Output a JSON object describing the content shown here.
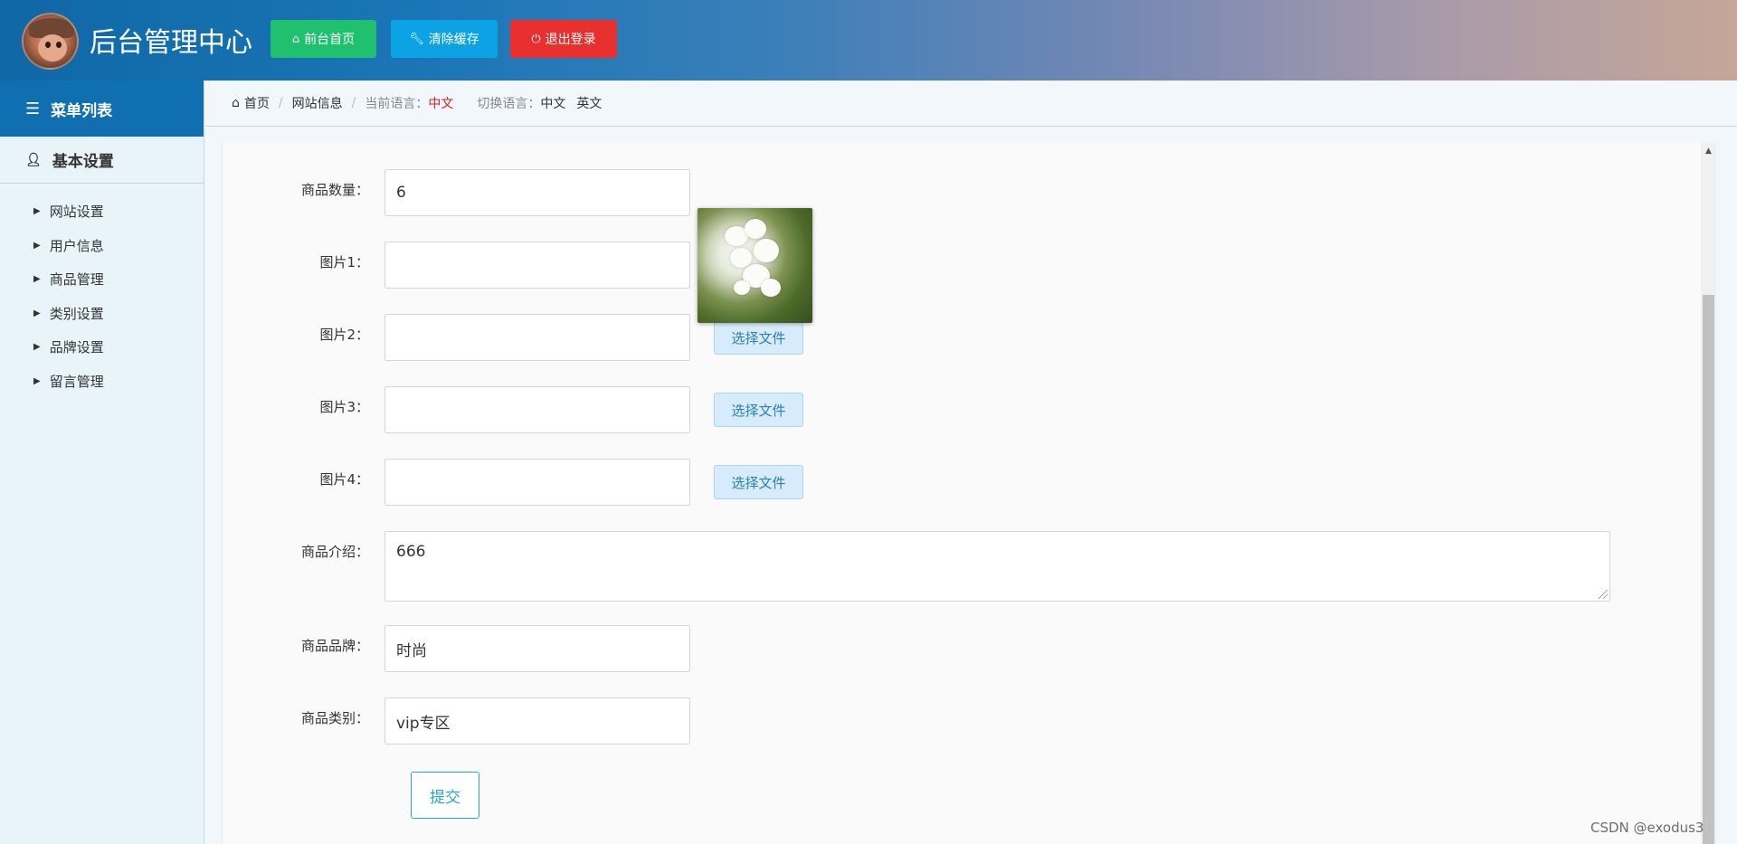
{
  "header": {
    "title": "后台管理中心",
    "buttons": {
      "home": "前台首页",
      "clear_cache": "清除缓存",
      "logout": "退出登录"
    },
    "colors": {
      "home": "#1fc06e",
      "clear_cache": "#0ca3e5",
      "logout": "#e8312f"
    }
  },
  "sidebar": {
    "menu_title": "菜单列表",
    "section_title": "基本设置",
    "items": [
      {
        "label": "网站设置"
      },
      {
        "label": "用户信息"
      },
      {
        "label": "商品管理"
      },
      {
        "label": "类别设置"
      },
      {
        "label": "品牌设置"
      },
      {
        "label": "留言管理"
      }
    ]
  },
  "breadcrumb": {
    "home": "首页",
    "current": "网站信息",
    "current_lang_label": "当前语言：",
    "current_lang_value": "中文",
    "switch_lang_label": "切换语言：",
    "lang_options": [
      "中文",
      "英文"
    ]
  },
  "form": {
    "fields": {
      "quantity": {
        "label": "商品数量：",
        "value": "6"
      },
      "image1": {
        "label": "图片1：",
        "value": ""
      },
      "image2": {
        "label": "图片2：",
        "value": ""
      },
      "image3": {
        "label": "图片3：",
        "value": ""
      },
      "image4": {
        "label": "图片4：",
        "value": ""
      },
      "intro": {
        "label": "商品介绍：",
        "value": "666"
      },
      "brand": {
        "label": "商品品牌：",
        "value": "时尚"
      },
      "category": {
        "label": "商品类别：",
        "value": "vip专区"
      }
    },
    "file_button": "选择文件",
    "submit": "提交"
  },
  "watermark": "CSDN @exodus3"
}
